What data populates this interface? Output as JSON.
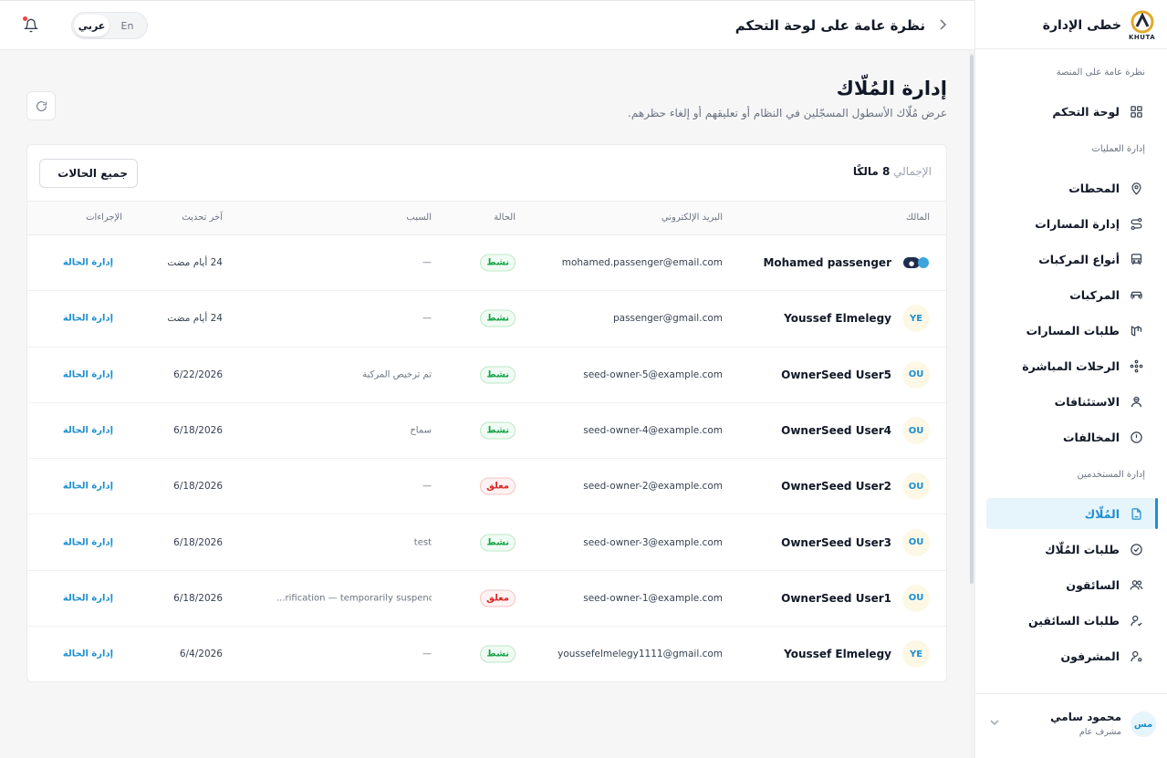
{
  "topbar": {
    "breadcrumb_title": "نظرة عامة على لوحة التحكم",
    "lang_ar": "عربي",
    "lang_en": "En"
  },
  "brand": {
    "name": "خطى الإدارة",
    "logo_text": "KHUTA"
  },
  "sidebar": {
    "sections": [
      {
        "label": "نظرة عامة على المنصة",
        "items": [
          {
            "label": "لوحة التحكم",
            "icon": "grid-icon"
          }
        ]
      },
      {
        "label": "إدارة العمليات",
        "items": [
          {
            "label": "المحطات",
            "icon": "location-pin-icon"
          },
          {
            "label": "إدارة المسارات",
            "icon": "route-icon"
          },
          {
            "label": "أنواع المركبات",
            "icon": "bus-icon"
          },
          {
            "label": "المركبات",
            "icon": "car-icon"
          },
          {
            "label": "طلبات المسارات",
            "icon": "route-request-icon"
          },
          {
            "label": "الرحلات المباشرة",
            "icon": "live-trips-icon"
          },
          {
            "label": "الاستئنافات",
            "icon": "appeals-icon"
          },
          {
            "label": "المخالفات",
            "icon": "alert-circle-icon"
          }
        ]
      },
      {
        "label": "إدارة المستخدمين",
        "items": [
          {
            "label": "المُلّاك",
            "icon": "document-icon",
            "active": true
          },
          {
            "label": "طلبات المُلّاك",
            "icon": "check-circle-icon"
          },
          {
            "label": "السائقون",
            "icon": "users-icon"
          },
          {
            "label": "طلبات السائقين",
            "icon": "user-check-icon"
          },
          {
            "label": "المشرفون",
            "icon": "user-settings-icon"
          }
        ]
      }
    ]
  },
  "user": {
    "initials": "مس",
    "name": "محمود سامي",
    "role": "مشرف عام"
  },
  "main": {
    "title": "إدارة المُلّاك",
    "subtitle": "عرض مُلّاك الأسطول المسجّلين في النظام أو تعليقهم أو إلغاء حظرهم."
  },
  "card": {
    "total_label": "الإجمالي",
    "total_value": "8 مالكًا",
    "filter_label": "جميع الحالات"
  },
  "table": {
    "columns": {
      "owner": "المالك",
      "email": "البريد الإلكتروني",
      "status": "الحالة",
      "reason": "السبب",
      "updated": "آخر تحديث",
      "actions": "الإجراءات"
    },
    "rows": [
      {
        "name": "Mohamed passenger",
        "initials": "",
        "logo": true,
        "email": "mohamed.passenger@email.com",
        "status": "نشط",
        "status_type": "active",
        "reason": "—",
        "updated": "24 أيام مضت",
        "action": "إدارة الحالة"
      },
      {
        "name": "Youssef Elmelegy",
        "initials": "YE",
        "email": "passenger@gmail.com",
        "status": "نشط",
        "status_type": "active",
        "reason": "—",
        "updated": "24 أيام مضت",
        "action": "إدارة الحالة"
      },
      {
        "name": "OwnerSeed User5",
        "initials": "OU",
        "email": "seed-owner-5@example.com",
        "status": "نشط",
        "status_type": "active",
        "reason": "تم ترخيص المركبة",
        "updated": "6/22/2026",
        "action": "إدارة الحالة"
      },
      {
        "name": "OwnerSeed User4",
        "initials": "OU",
        "email": "seed-owner-4@example.com",
        "status": "نشط",
        "status_type": "active",
        "reason": "سماح",
        "updated": "6/18/2026",
        "action": "إدارة الحالة"
      },
      {
        "name": "OwnerSeed User2",
        "initials": "OU",
        "email": "seed-owner-2@example.com",
        "status": "معلق",
        "status_type": "suspended",
        "reason": "—",
        "updated": "6/18/2026",
        "action": "إدارة الحالة"
      },
      {
        "name": "OwnerSeed User3",
        "initials": "OU",
        "email": "seed-owner-3@example.com",
        "status": "نشط",
        "status_type": "active",
        "reason": "test",
        "updated": "6/18/2026",
        "action": "إدارة الحالة"
      },
      {
        "name": "OwnerSeed User1",
        "initials": "OU",
        "email": "seed-owner-1@example.com",
        "status": "معلق",
        "status_type": "suspended",
        "reason": "...rification — temporarily suspended",
        "updated": "6/18/2026",
        "action": "إدارة الحالة"
      },
      {
        "name": "Youssef Elmelegy",
        "initials": "YE",
        "email": "youssefelmelegy1111@gmail.com",
        "status": "نشط",
        "status_type": "active",
        "reason": "—",
        "updated": "6/4/2026",
        "action": "إدارة الحالة"
      }
    ]
  },
  "colors": {
    "accent": "#1d8fd0",
    "active_green": "#16a34a",
    "suspended_red": "#dc2626"
  }
}
